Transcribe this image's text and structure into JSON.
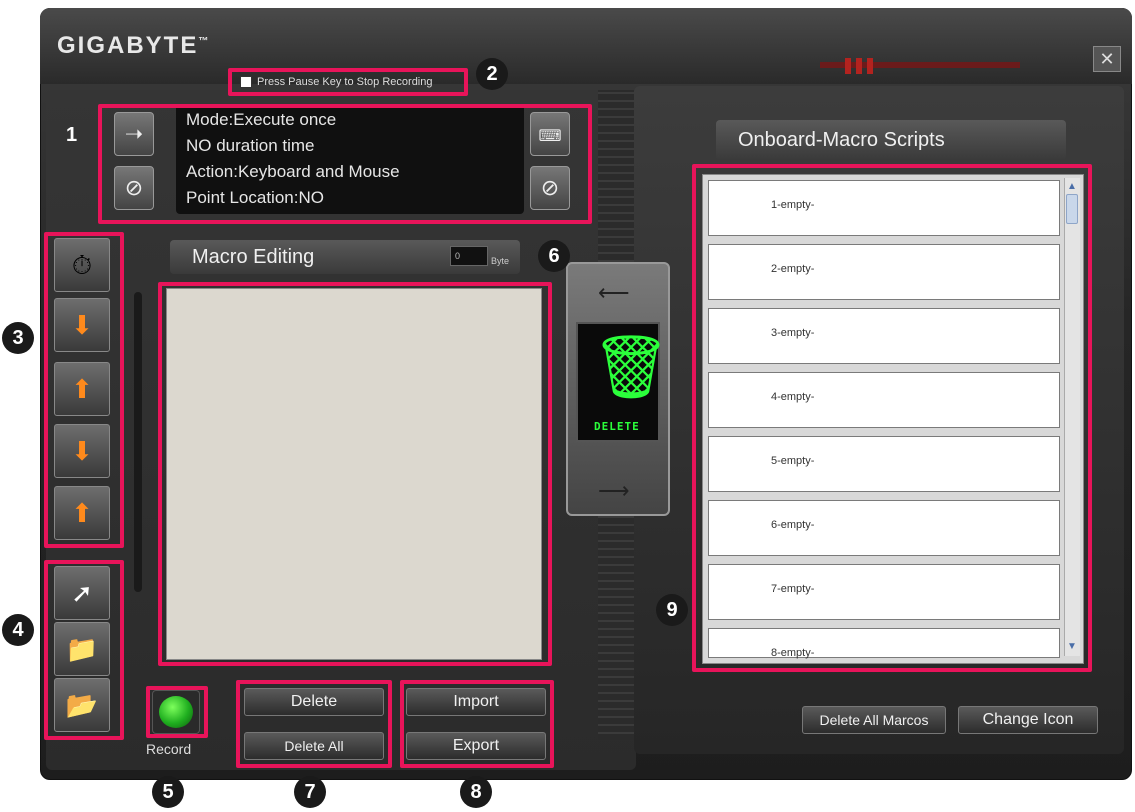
{
  "app": {
    "brand": "GIGABYTE",
    "trademark": "™"
  },
  "close_glyph": "✕",
  "recording": {
    "checkbox_label": "Press Pause Key to Stop Recording"
  },
  "info": {
    "lines": [
      "Mode:Execute once",
      "NO duration time",
      "Action:Keyboard and Mouse",
      "Point Location:NO"
    ]
  },
  "macro_editing": {
    "title": "Macro Editing",
    "byte_value": "0",
    "byte_unit": "Byte"
  },
  "trash": {
    "label": "DELETE"
  },
  "buttons": {
    "record": "Record",
    "delete": "Delete",
    "delete_all": "Delete All",
    "import": "Import",
    "export": "Export",
    "delete_all_macros": "Delete All Marcos",
    "change_icon": "Change Icon"
  },
  "scripts": {
    "title": "Onboard-Macro Scripts",
    "items": [
      "1-empty-",
      "2-empty-",
      "3-empty-",
      "4-empty-",
      "5-empty-",
      "6-empty-",
      "7-empty-",
      "8-empty-"
    ]
  },
  "callouts": [
    "1",
    "2",
    "3",
    "4",
    "5",
    "6",
    "7",
    "8",
    "9"
  ],
  "colors": {
    "highlight": "#e8145a",
    "record_green": "#1fae1f",
    "trash_green": "#2bff3b"
  }
}
